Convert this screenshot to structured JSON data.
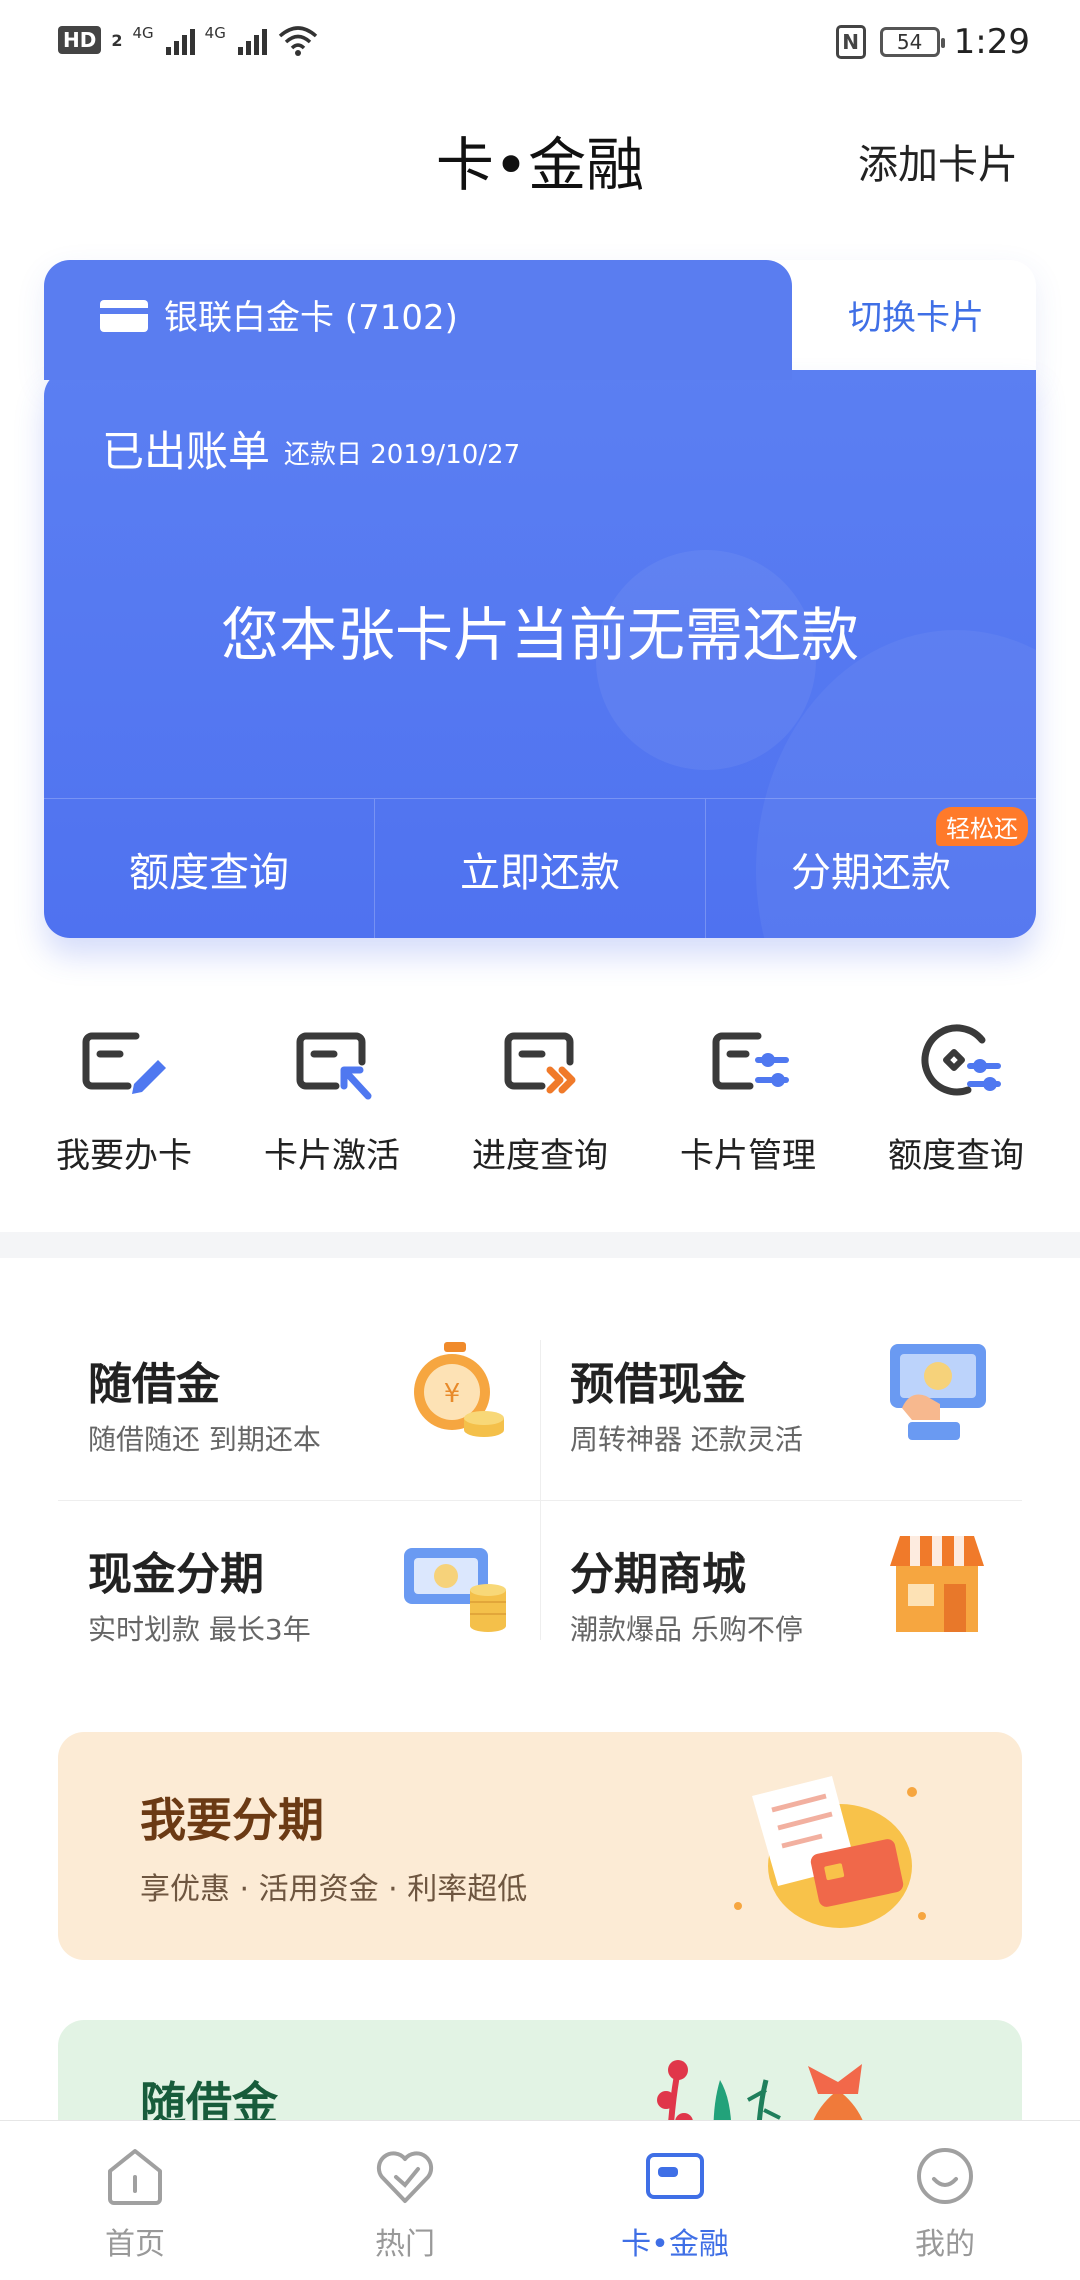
{
  "status_bar": {
    "hd": "HD",
    "sim_slot": "2",
    "net1": "4G",
    "net2": "4G",
    "battery": "54",
    "time": "1:29"
  },
  "header": {
    "title": "卡•金融",
    "action": "添加卡片"
  },
  "card": {
    "name": "银联白金卡 (7102)",
    "switch_label": "切换卡片",
    "bill_status": "已出账单",
    "due_date": "还款日 2019/10/27",
    "message": "您本张卡片当前无需还款",
    "actions": [
      {
        "label": "额度查询"
      },
      {
        "label": "立即还款"
      },
      {
        "label": "分期还款",
        "badge": "轻松还"
      }
    ],
    "color": "#5a7df0"
  },
  "quick_actions": [
    {
      "label": "我要办卡",
      "icon": "card-pen-icon"
    },
    {
      "label": "卡片激活",
      "icon": "card-activate-icon"
    },
    {
      "label": "进度查询",
      "icon": "card-progress-icon"
    },
    {
      "label": "卡片管理",
      "icon": "card-manage-icon"
    },
    {
      "label": "额度查询",
      "icon": "quota-query-icon"
    }
  ],
  "finance": [
    {
      "title": "随借金",
      "sub": "随借随还 到期还本",
      "icon": "stopwatch-coins-icon"
    },
    {
      "title": "预借现金",
      "sub": "周转神器 还款灵活",
      "icon": "hand-cash-icon"
    },
    {
      "title": "现金分期",
      "sub": "实时划款 最长3年",
      "icon": "banknote-coins-icon"
    },
    {
      "title": "分期商城",
      "sub": "潮款爆品 乐购不停",
      "icon": "store-icon"
    }
  ],
  "promos": {
    "installment": {
      "title": "我要分期",
      "sub": "享优惠 · 活用资金 · 利率超低",
      "bg": "#fcebd5"
    },
    "credit": {
      "title": "随借金",
      "bg": "#e2f3e4"
    }
  },
  "nav": [
    {
      "label": "首页",
      "icon": "home-icon"
    },
    {
      "label": "热门",
      "icon": "heart-icon"
    },
    {
      "label": "卡•金融",
      "icon": "card-icon",
      "active": true
    },
    {
      "label": "我的",
      "icon": "profile-icon"
    }
  ],
  "accent_color": "#3f6fe6"
}
